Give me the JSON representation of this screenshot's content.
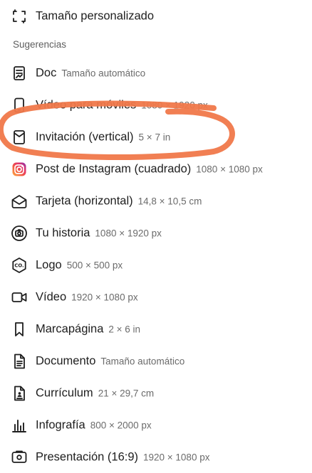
{
  "header_item": {
    "label": "Tamaño personalizado",
    "icon": "custom-size-icon"
  },
  "section_title": "Sugerencias",
  "items": [
    {
      "label": "Doc",
      "dims": "Tamaño automático",
      "icon": "doc-icon"
    },
    {
      "label": "Vídeo para móviles",
      "dims": "1080 × 1920 px",
      "icon": "mobile-icon"
    },
    {
      "label": "Invitación (vertical)",
      "dims": "5 × 7 in",
      "icon": "invitation-icon"
    },
    {
      "label": "Post de Instagram (cuadrado)",
      "dims": "1080 × 1080 px",
      "icon": "instagram-icon"
    },
    {
      "label": "Tarjeta (horizontal)",
      "dims": "14,8 × 10,5 cm",
      "icon": "card-icon"
    },
    {
      "label": "Tu historia",
      "dims": "1080 × 1920 px",
      "icon": "camera-icon"
    },
    {
      "label": "Logo",
      "dims": "500 × 500 px",
      "icon": "logo-icon"
    },
    {
      "label": "Vídeo",
      "dims": "1920 × 1080 px",
      "icon": "video-icon"
    },
    {
      "label": "Marcapágina",
      "dims": "2 × 6 in",
      "icon": "bookmark-icon"
    },
    {
      "label": "Documento",
      "dims": "Tamaño automático",
      "icon": "document-icon"
    },
    {
      "label": "Currículum",
      "dims": "21 × 29,7 cm",
      "icon": "resume-icon"
    },
    {
      "label": "Infografía",
      "dims": "800 × 2000 px",
      "icon": "infographic-icon"
    },
    {
      "label": "Presentación (16:9)",
      "dims": "1920 × 1080 px",
      "icon": "presentation-icon"
    }
  ],
  "icon_text": {
    "logo": "CO."
  },
  "colors": {
    "text": "#1e1e1e",
    "secondary": "#6b6b6b",
    "annotation": "#f0784a"
  }
}
